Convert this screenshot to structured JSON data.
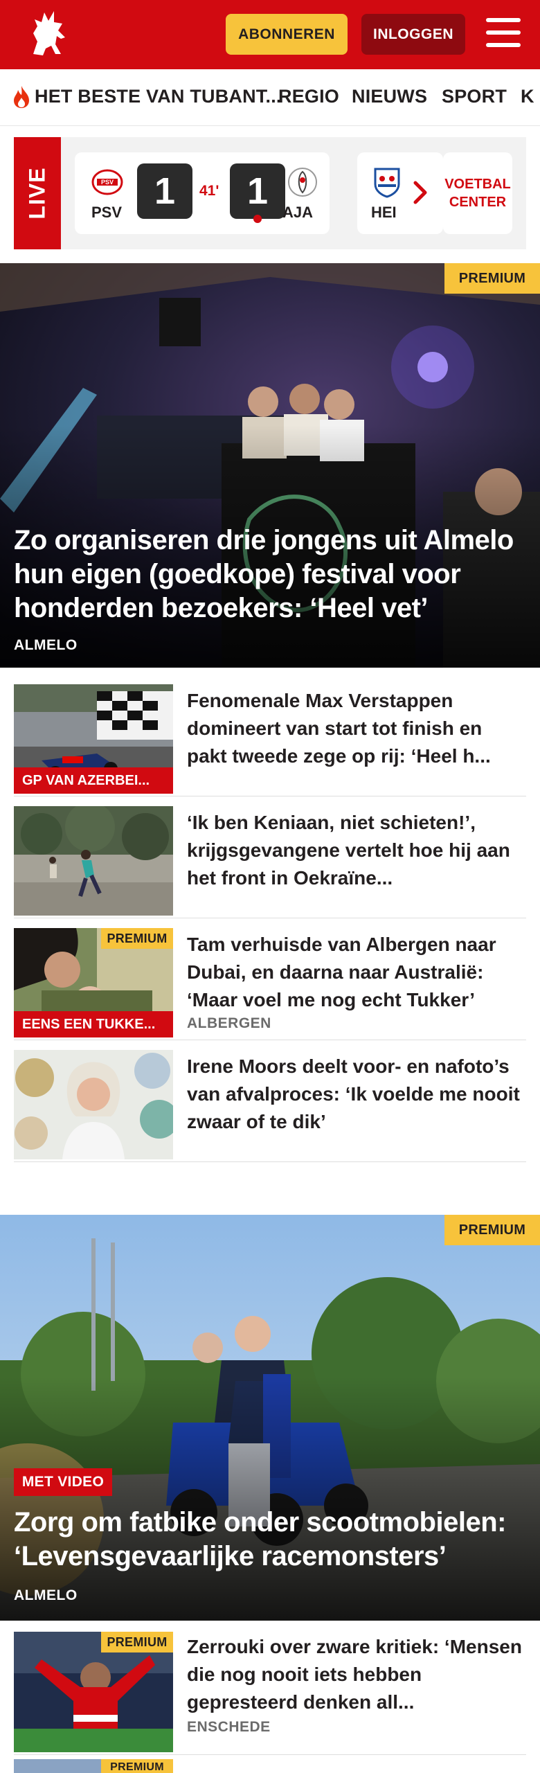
{
  "header": {
    "subscribe_label": "ABONNEREN",
    "login_label": "INLOGGEN",
    "brand_color": "#d10a11",
    "accent_color": "#f7c33b"
  },
  "nav": {
    "items": [
      "HET BESTE VAN TUBANT...",
      "REGIO",
      "NIEUWS",
      "SPORT",
      "K"
    ]
  },
  "live": {
    "tab_label": "LIVE",
    "match": {
      "home_team": "PSV",
      "home_score": "1",
      "minute": "41'",
      "away_score": "1",
      "away_team": "AJA"
    },
    "next_match_team": "HEI",
    "voetbal_center_label": "VOETBAL CENTER"
  },
  "hero1": {
    "premium_label": "PREMIUM",
    "title": "Zo organiseren drie jongens uit Almelo hun eigen (goedkope) festival voor honderden bezoekers: ‘Heel vet’",
    "tag": "ALMELO"
  },
  "articles": [
    {
      "title": "Fenomenale Max Verstappen domineert van start tot finish en pakt tweede zege op rij: ‘Heel h...",
      "thumb_label": "GP VAN AZERBEI...",
      "premium": "",
      "tag": ""
    },
    {
      "title": "‘Ik ben Keniaan, niet schieten!’, krijgsgevangene vertelt hoe hij aan het front in Oekraïne...",
      "thumb_label": "",
      "premium": "",
      "tag": ""
    },
    {
      "title": "Tam verhuisde van Albergen naar Dubai, en daarna naar Australië: ‘Maar voel me nog echt Tukker’",
      "thumb_label": "EENS EEN TUKKE...",
      "premium": "PREMIUM",
      "tag": "ALBERGEN"
    },
    {
      "title": "Irene Moors deelt voor- en nafoto’s van afvalproces: ‘Ik voelde me nooit zwaar of te dik’",
      "thumb_label": "",
      "premium": "",
      "tag": ""
    }
  ],
  "hero2": {
    "premium_label": "PREMIUM",
    "video_label": "MET VIDEO",
    "title": "Zorg om fatbike onder scootmobielen: ‘Levensgevaarlijke racemonsters’",
    "tag": "ALMELO"
  },
  "article_bottom": {
    "title": "Zerrouki over zware kritiek: ‘Mensen die nog nooit iets hebben gepresteerd denken all...",
    "premium": "PREMIUM",
    "tag": "ENSCHEDE"
  },
  "article_cut": {
    "premium": "PREMIUM"
  }
}
